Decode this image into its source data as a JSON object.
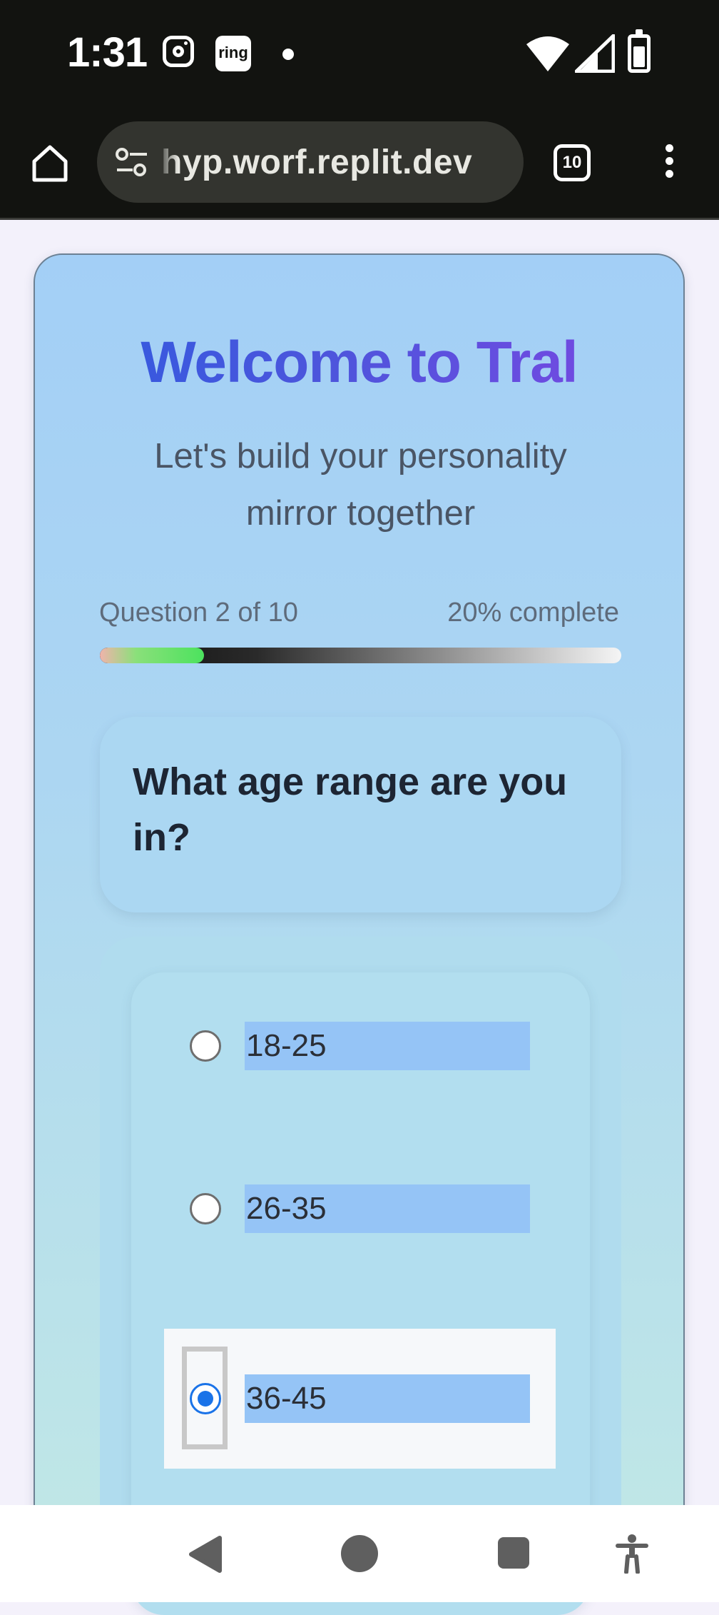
{
  "status_bar": {
    "time": "1:31",
    "icons": [
      "instagram-icon",
      "ring-icon",
      "notification-dot-icon",
      "wifi-icon",
      "signal-icon",
      "battery-icon"
    ],
    "ring_label": "ring"
  },
  "browser": {
    "url": "hyp.worf.replit.dev",
    "tab_count": "10",
    "icons": [
      "home-icon",
      "site-settings-icon",
      "tabs-icon",
      "more-menu-icon"
    ]
  },
  "page": {
    "title": "Welcome to Tral",
    "subtitle": "Let's build your personality mirror together",
    "progress": {
      "label": "Question 2 of 10",
      "percent_label": "20% complete",
      "value": 0.2
    },
    "question": "What age range are you in?",
    "options": [
      {
        "label": "18-25",
        "selected": false
      },
      {
        "label": "26-35",
        "selected": false
      },
      {
        "label": "36-45",
        "selected": true
      }
    ]
  },
  "colors": {
    "title_gradient_start": "#2e5be0",
    "title_gradient_end": "#7d46e2",
    "card_background": "#a3cff6",
    "radio_selected": "#1a73e8",
    "option_label_highlight": "#95c4f6"
  },
  "nav_bar": {
    "icons": [
      "back-icon",
      "home-circle-icon",
      "recents-icon",
      "accessibility-icon"
    ]
  }
}
